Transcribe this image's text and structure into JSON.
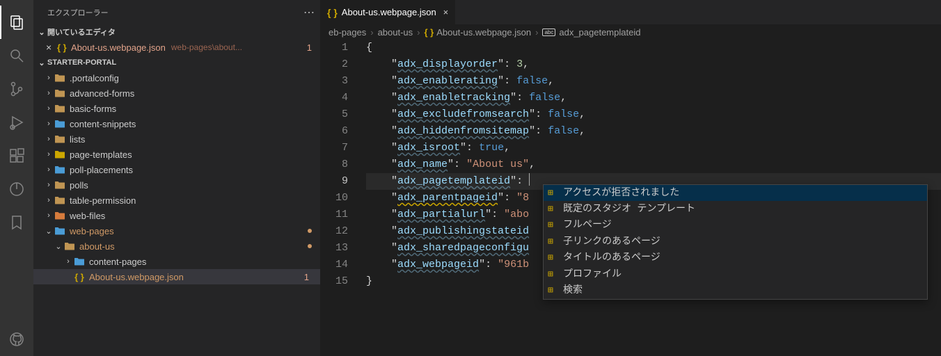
{
  "sidebar": {
    "title": "エクスプローラー",
    "open_editors_label": "開いているエディタ",
    "open_editor": {
      "filename": "About-us.webpage.json",
      "path": "web-pages\\about...",
      "badge": "1"
    },
    "workspace_label": "STARTER-PORTAL",
    "tree": [
      {
        "label": ".portalconfig",
        "type": "folder",
        "indent": 1
      },
      {
        "label": "advanced-forms",
        "type": "folder",
        "indent": 1
      },
      {
        "label": "basic-forms",
        "type": "folder",
        "indent": 1
      },
      {
        "label": "content-snippets",
        "type": "folder-special",
        "indent": 1
      },
      {
        "label": "lists",
        "type": "folder",
        "indent": 1
      },
      {
        "label": "page-templates",
        "type": "folder-yellow",
        "indent": 1
      },
      {
        "label": "poll-placements",
        "type": "folder-special",
        "indent": 1
      },
      {
        "label": "polls",
        "type": "folder",
        "indent": 1
      },
      {
        "label": "table-permission",
        "type": "folder",
        "indent": 1
      },
      {
        "label": "web-files",
        "type": "folder-orange",
        "indent": 1
      },
      {
        "label": "web-pages",
        "type": "folder-blue",
        "indent": 1,
        "orange": true,
        "expanded": true,
        "dot": true
      },
      {
        "label": "about-us",
        "type": "folder",
        "indent": 2,
        "orange": true,
        "expanded": true,
        "dot": true
      },
      {
        "label": "content-pages",
        "type": "folder-blue",
        "indent": 3
      },
      {
        "label": "About-us.webpage.json",
        "type": "json",
        "indent": 3,
        "orange": true,
        "selected": true,
        "num": "1"
      }
    ]
  },
  "tab": {
    "filename": "About-us.webpage.json"
  },
  "breadcrumb": {
    "parts": [
      "eb-pages",
      "about-us",
      "About-us.webpage.json",
      "adx_pagetemplateid"
    ]
  },
  "code": {
    "lines": [
      {
        "n": 1,
        "segs": [
          [
            "punc",
            "{"
          ]
        ]
      },
      {
        "n": 2,
        "segs": [
          [
            "pad",
            "    "
          ],
          [
            "punc",
            "\""
          ],
          [
            "key",
            "adx_displayorder"
          ],
          [
            "punc",
            "\": "
          ],
          [
            "num",
            "3"
          ],
          [
            "punc",
            ","
          ]
        ]
      },
      {
        "n": 3,
        "segs": [
          [
            "pad",
            "    "
          ],
          [
            "punc",
            "\""
          ],
          [
            "key",
            "adx_enablerating"
          ],
          [
            "punc",
            "\": "
          ],
          [
            "kw",
            "false"
          ],
          [
            "punc",
            ","
          ]
        ]
      },
      {
        "n": 4,
        "segs": [
          [
            "pad",
            "    "
          ],
          [
            "punc",
            "\""
          ],
          [
            "key",
            "adx_enabletracking"
          ],
          [
            "punc",
            "\": "
          ],
          [
            "kw",
            "false"
          ],
          [
            "punc",
            ","
          ]
        ]
      },
      {
        "n": 5,
        "segs": [
          [
            "pad",
            "    "
          ],
          [
            "punc",
            "\""
          ],
          [
            "key",
            "adx_excludefromsearch"
          ],
          [
            "punc",
            "\": "
          ],
          [
            "kw",
            "false"
          ],
          [
            "punc",
            ","
          ]
        ]
      },
      {
        "n": 6,
        "segs": [
          [
            "pad",
            "    "
          ],
          [
            "punc",
            "\""
          ],
          [
            "key",
            "adx_hiddenfromsitemap"
          ],
          [
            "punc",
            "\": "
          ],
          [
            "kw",
            "false"
          ],
          [
            "punc",
            ","
          ]
        ]
      },
      {
        "n": 7,
        "segs": [
          [
            "pad",
            "    "
          ],
          [
            "punc",
            "\""
          ],
          [
            "key",
            "adx_isroot"
          ],
          [
            "punc",
            "\": "
          ],
          [
            "kw",
            "true"
          ],
          [
            "punc",
            ","
          ]
        ]
      },
      {
        "n": 8,
        "segs": [
          [
            "pad",
            "    "
          ],
          [
            "punc",
            "\""
          ],
          [
            "key",
            "adx_name"
          ],
          [
            "punc",
            "\": "
          ],
          [
            "str",
            "\"About us\""
          ],
          [
            "punc",
            ","
          ]
        ]
      },
      {
        "n": 9,
        "active": true,
        "segs": [
          [
            "pad",
            "    "
          ],
          [
            "punc",
            "\""
          ],
          [
            "key",
            "adx_pagetemplateid"
          ],
          [
            "punc",
            "\": "
          ],
          [
            "cursor",
            ""
          ]
        ]
      },
      {
        "n": 10,
        "segs": [
          [
            "pad",
            "    "
          ],
          [
            "punc",
            "\""
          ],
          [
            "keywarn",
            "adx_parentpageid"
          ],
          [
            "punc",
            "\": "
          ],
          [
            "str",
            "\"8"
          ]
        ]
      },
      {
        "n": 11,
        "segs": [
          [
            "pad",
            "    "
          ],
          [
            "punc",
            "\""
          ],
          [
            "key",
            "adx_partialurl"
          ],
          [
            "punc",
            "\": "
          ],
          [
            "str",
            "\"abo"
          ]
        ]
      },
      {
        "n": 12,
        "segs": [
          [
            "pad",
            "    "
          ],
          [
            "punc",
            "\""
          ],
          [
            "key",
            "adx_publishingstateid"
          ]
        ]
      },
      {
        "n": 13,
        "segs": [
          [
            "pad",
            "    "
          ],
          [
            "punc",
            "\""
          ],
          [
            "key",
            "adx_sharedpageconfigu"
          ]
        ]
      },
      {
        "n": 14,
        "segs": [
          [
            "pad",
            "    "
          ],
          [
            "punc",
            "\""
          ],
          [
            "key",
            "adx_webpageid"
          ],
          [
            "punc",
            "\": "
          ],
          [
            "str",
            "\"961b"
          ]
        ]
      },
      {
        "n": 15,
        "segs": [
          [
            "punc",
            "}"
          ]
        ]
      }
    ]
  },
  "suggest": {
    "items": [
      "アクセスが拒否されました",
      "既定のスタジオ テンプレート",
      "フルページ",
      "子リンクのあるページ",
      "タイトルのあるページ",
      "プロファイル",
      "検索"
    ]
  }
}
